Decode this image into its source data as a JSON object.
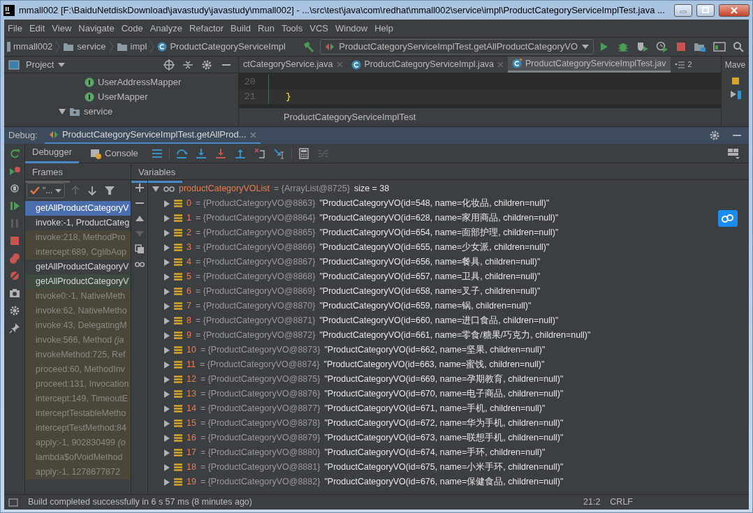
{
  "window": {
    "title": "mmall002 [F:\\BaiduNetdiskDownload\\javastudy\\javastudy\\mmall002] - ...\\src\\test\\java\\com\\redhat\\mmall002\\service\\impl\\ProductCategoryServiceImplTest.java ..."
  },
  "menu": [
    "File",
    "Edit",
    "View",
    "Navigate",
    "Code",
    "Analyze",
    "Refactor",
    "Build",
    "Run",
    "Tools",
    "VCS",
    "Window",
    "Help"
  ],
  "breadcrumb": [
    {
      "label": "mmall002",
      "kind": "module"
    },
    {
      "label": "service",
      "kind": "folder"
    },
    {
      "label": "impl",
      "kind": "folder"
    },
    {
      "label": "ProductCategoryServiceImpl",
      "kind": "class"
    }
  ],
  "run_config": {
    "label": "ProductCategoryServiceImplTest.getAllProductCategoryVO"
  },
  "project_panel": {
    "title": "Project",
    "tree": [
      {
        "label": "UserAddressMapper",
        "kind": "interface"
      },
      {
        "label": "UserMapper",
        "kind": "interface"
      },
      {
        "label": "service",
        "kind": "package",
        "expanded": true
      }
    ]
  },
  "editor": {
    "tabs": [
      {
        "label": "ctCategoryService.java",
        "selected": false
      },
      {
        "label": "ProductCategoryServiceImpl.java",
        "selected": false
      },
      {
        "label": "ProductCategoryServiceImplTest.jav",
        "selected": true
      }
    ],
    "tab_count": "2",
    "side_tab": "Mave",
    "lines": [
      {
        "number": "20"
      },
      {
        "number": "21",
        "code": "}"
      }
    ],
    "breadcrumb": "ProductCategoryServiceImplTest"
  },
  "debug": {
    "label": "Debug:",
    "session_tab": "ProductCategoryServiceImplTest.getAllProd...",
    "tabs": [
      {
        "label": "Debugger",
        "selected": true
      },
      {
        "label": "Console",
        "selected": false
      }
    ],
    "frames_title": "Frames",
    "variables_title": "Variables",
    "thread": "\"...",
    "frames": [
      {
        "label": "getAllProductCategoryV",
        "kind": "app",
        "selected": true
      },
      {
        "label": "invoke:-1, ProductCateg",
        "kind": "app",
        "selected": false
      },
      {
        "label": "invoke:218, MethodPro",
        "kind": "library",
        "selected": false
      },
      {
        "label": "intercept:689, CglibAop",
        "kind": "library",
        "selected": false
      },
      {
        "label": "getAllProductCategoryV",
        "kind": "app",
        "selected": false
      },
      {
        "label": "getAllProductCategoryV",
        "kind": "test",
        "selected": false
      },
      {
        "label": "invoke0:-1, NativeMeth",
        "kind": "library",
        "selected": false
      },
      {
        "label": "invoke:62, NativeMetho",
        "kind": "library",
        "selected": false
      },
      {
        "label": "invoke:43, DelegatingM",
        "kind": "library",
        "selected": false
      },
      {
        "label": "invoke:566, Method *(ja*",
        "kind": "library",
        "selected": false
      },
      {
        "label": "invokeMethod:725, Ref",
        "kind": "library",
        "selected": false
      },
      {
        "label": "proceed:60, MethodInv",
        "kind": "library",
        "selected": false
      },
      {
        "label": "proceed:131, Invocation",
        "kind": "library",
        "selected": false
      },
      {
        "label": "intercept:149, TimeoutE",
        "kind": "library",
        "selected": false
      },
      {
        "label": "interceptTestableMetho",
        "kind": "library",
        "selected": false
      },
      {
        "label": "interceptTestMethod:84",
        "kind": "library",
        "selected": false
      },
      {
        "label": "apply:-1, 902830499 *(o*",
        "kind": "library",
        "selected": false
      },
      {
        "label": "lambda$ofVoidMethod",
        "kind": "library",
        "selected": false
      },
      {
        "label": "apply:-1, 1278677872",
        "kind": "library",
        "selected": false
      }
    ],
    "variables": {
      "name": "productCategoryVOList",
      "ref": "= {ArrayList@8725}",
      "size": "size = 38",
      "expanded": true,
      "items": [
        {
          "name": "0",
          "ref": "= {ProductCategoryVO@8863}",
          "value": "\"ProductCategoryVO(id=548, name=化妆品, children=null)\""
        },
        {
          "name": "1",
          "ref": "= {ProductCategoryVO@8864}",
          "value": "\"ProductCategoryVO(id=628, name=家用商品, children=null)\""
        },
        {
          "name": "2",
          "ref": "= {ProductCategoryVO@8865}",
          "value": "\"ProductCategoryVO(id=654, name=面部护理, children=null)\""
        },
        {
          "name": "3",
          "ref": "= {ProductCategoryVO@8866}",
          "value": "\"ProductCategoryVO(id=655, name=少女派, children=null)\""
        },
        {
          "name": "4",
          "ref": "= {ProductCategoryVO@8867}",
          "value": "\"ProductCategoryVO(id=656, name=餐具, children=null)\""
        },
        {
          "name": "5",
          "ref": "= {ProductCategoryVO@8868}",
          "value": "\"ProductCategoryVO(id=657, name=卫具, children=null)\""
        },
        {
          "name": "6",
          "ref": "= {ProductCategoryVO@8869}",
          "value": "\"ProductCategoryVO(id=658, name=叉子, children=null)\""
        },
        {
          "name": "7",
          "ref": "= {ProductCategoryVO@8870}",
          "value": "\"ProductCategoryVO(id=659, name=锅, children=null)\""
        },
        {
          "name": "8",
          "ref": "= {ProductCategoryVO@8871}",
          "value": "\"ProductCategoryVO(id=660, name=进口食品, children=null)\""
        },
        {
          "name": "9",
          "ref": "= {ProductCategoryVO@8872}",
          "value": "\"ProductCategoryVO(id=661, name=零食/糖果/巧克力, children=null)\""
        },
        {
          "name": "10",
          "ref": "= {ProductCategoryVO@8873}",
          "value": "\"ProductCategoryVO(id=662, name=坚果, children=null)\""
        },
        {
          "name": "11",
          "ref": "= {ProductCategoryVO@8874}",
          "value": "\"ProductCategoryVO(id=663, name=蜜饯, children=null)\""
        },
        {
          "name": "12",
          "ref": "= {ProductCategoryVO@8875}",
          "value": "\"ProductCategoryVO(id=669, name=孕期教育, children=null)\""
        },
        {
          "name": "13",
          "ref": "= {ProductCategoryVO@8876}",
          "value": "\"ProductCategoryVO(id=670, name=电子商品, children=null)\""
        },
        {
          "name": "14",
          "ref": "= {ProductCategoryVO@8877}",
          "value": "\"ProductCategoryVO(id=671, name=手机, children=null)\""
        },
        {
          "name": "15",
          "ref": "= {ProductCategoryVO@8878}",
          "value": "\"ProductCategoryVO(id=672, name=华为手机, children=null)\""
        },
        {
          "name": "16",
          "ref": "= {ProductCategoryVO@8879}",
          "value": "\"ProductCategoryVO(id=673, name=联想手机, children=null)\""
        },
        {
          "name": "17",
          "ref": "= {ProductCategoryVO@8880}",
          "value": "\"ProductCategoryVO(id=674, name=手环, children=null)\""
        },
        {
          "name": "18",
          "ref": "= {ProductCategoryVO@8881}",
          "value": "\"ProductCategoryVO(id=675, name=小米手环, children=null)\""
        },
        {
          "name": "19",
          "ref": "= {ProductCategoryVO@8882}",
          "value": "\"ProductCategoryVO(id=676, name=保健食品, children=null)\""
        }
      ]
    }
  },
  "status_bar": {
    "message": "Build completed successfully in 6 s 57 ms (8 minutes ago)",
    "position": "21:2",
    "line_separator": "CRLF"
  }
}
